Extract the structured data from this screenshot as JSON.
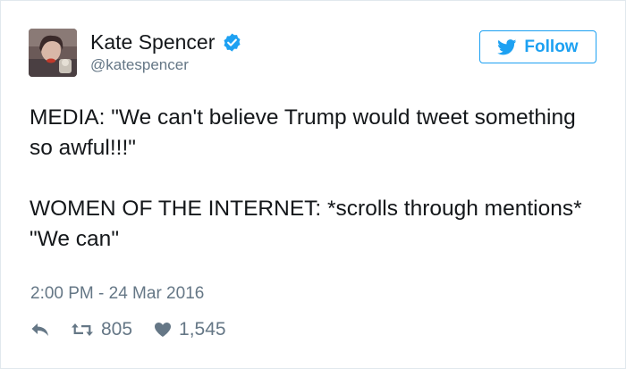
{
  "user": {
    "name": "Kate Spencer",
    "handle": "@katespencer",
    "verified": true
  },
  "follow_button": {
    "label": "Follow"
  },
  "tweet": {
    "lines": [
      "MEDIA: \"We can't believe Trump would tweet something so awful!!!\"",
      "WOMEN OF THE INTERNET: *scrolls through mentions*",
      "\"We can\""
    ],
    "timestamp": "2:00 PM - 24 Mar 2016"
  },
  "stats": {
    "retweets": "805",
    "likes": "1,545"
  },
  "colors": {
    "accent": "#1da1f2",
    "muted": "#657786",
    "text": "#14171a"
  },
  "icons": [
    "reply-icon",
    "retweet-icon",
    "heart-icon",
    "twitter-bird-icon",
    "verified-badge-icon"
  ]
}
